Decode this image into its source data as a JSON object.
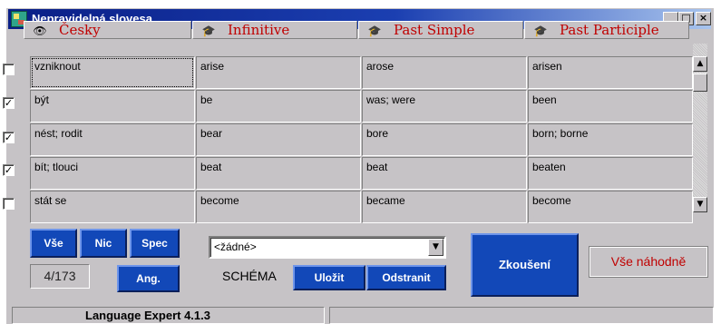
{
  "window": {
    "title": "Nepravidelná slovesa"
  },
  "titlebar_controls": {
    "minimize": "_",
    "maximize": "□",
    "close": "×"
  },
  "columns": [
    {
      "label": "Česky",
      "icon": "eye-icon",
      "glyph": "👁"
    },
    {
      "label": "Infinitive",
      "icon": "graduation-cap-icon",
      "glyph": "🎓"
    },
    {
      "label": "Past Simple",
      "icon": "graduation-cap-icon",
      "glyph": "🎓"
    },
    {
      "label": "Past Participle",
      "icon": "graduation-cap-icon",
      "glyph": "🎓"
    }
  ],
  "rows": [
    {
      "checked": false,
      "check_mark": "",
      "cesky": "vzniknout",
      "infinitive": "arise",
      "past_simple": "arose",
      "past_participle": "arisen"
    },
    {
      "checked": true,
      "check_mark": "✓",
      "cesky": "být",
      "infinitive": "be",
      "past_simple": "was; were",
      "past_participle": "been"
    },
    {
      "checked": true,
      "check_mark": "✓",
      "cesky": "nést; rodit",
      "infinitive": "bear",
      "past_simple": "bore",
      "past_participle": "born; borne"
    },
    {
      "checked": true,
      "check_mark": "✓",
      "cesky": "bít; tlouci",
      "infinitive": "beat",
      "past_simple": "beat",
      "past_participle": "beaten"
    },
    {
      "checked": false,
      "check_mark": "",
      "cesky": "stát se",
      "infinitive": "become",
      "past_simple": "became",
      "past_participle": "become"
    }
  ],
  "scrollbar": {
    "up_arrow": "▲",
    "down_arrow": "▼"
  },
  "buttons": {
    "all": "Vše",
    "none": "Nic",
    "spec": "Spec",
    "ang": "Ang.",
    "save": "Uložit",
    "remove": "Odstranit",
    "test": "Zkoušení",
    "random_all": "Vše náhodně"
  },
  "counter": "4/173",
  "schema": {
    "label": "SCHÉMA",
    "selected": "<žádné>",
    "arrow": "▼"
  },
  "status": {
    "app_version": "Language Expert 4.1.3",
    "right": ""
  }
}
